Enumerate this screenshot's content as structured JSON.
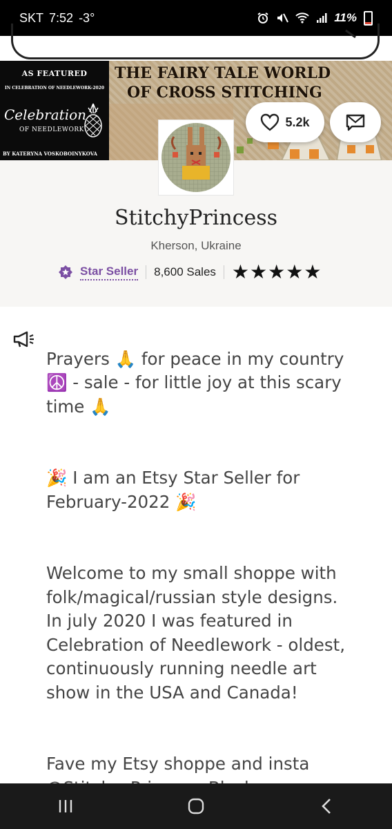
{
  "status_bar": {
    "carrier": "SKT",
    "time": "7:52",
    "temperature": "-3°",
    "battery": "11%"
  },
  "banner": {
    "featured_heading": "AS FEATURED",
    "featured_sub": "IN CELEBRATION OF NEEDLEWORK-2020",
    "logo_script": "Celebration",
    "logo_sub": "OF NEEDLEWORK",
    "author": "BY KATERYNA VOSKOBOINYKOVA",
    "title_line1": "THE FAIRY TALE WORLD",
    "title_line2": "OF CROSS STITCHING"
  },
  "actions": {
    "favorites_count": "5.2k"
  },
  "shop": {
    "name": "StitchyPrincess",
    "location": "Kherson, Ukraine",
    "badge_label": "Star Seller",
    "sales": "8,600 Sales",
    "rating": 5
  },
  "announcement": {
    "paragraphs": [
      "Prayers 🙏 for peace in my country ☮️ - sale - for little joy at this scary time 🙏",
      "🎉 I am an Etsy Star Seller for February-2022 🎉",
      "Welcome to my small shoppe with folk/magical/russian style designs.\nIn july 2020 I was featured in Celebration of Needlework - oldest, continuously running needle art show in the USA and Canada!",
      "Fave my Etsy shoppe and insta @Stitchy_Princess_Black"
    ]
  },
  "colors": {
    "accent": "#7b4fa3",
    "status_bar": "#000000",
    "nav_bar": "#1a1a1a"
  }
}
